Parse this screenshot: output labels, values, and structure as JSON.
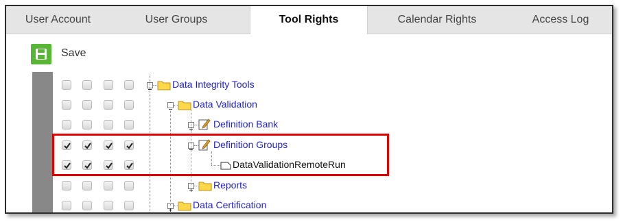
{
  "tabs": [
    {
      "label": "User Account",
      "active": false
    },
    {
      "label": "User Groups",
      "active": false
    },
    {
      "label": "Tool Rights",
      "active": true
    },
    {
      "label": "Calendar Rights",
      "active": false
    },
    {
      "label": "Access Log",
      "active": false
    }
  ],
  "toolbar": {
    "save_label": "Save"
  },
  "tree": {
    "rows": [
      {
        "label": "Data Integrity Tools",
        "icon": "folder-icon",
        "expanded": true,
        "checked": false
      },
      {
        "label": "Data Validation",
        "icon": "folder-icon",
        "expanded": true,
        "checked": false
      },
      {
        "label": "Definition Bank",
        "icon": "edit-document-icon",
        "expanded": false,
        "checked": false
      },
      {
        "label": "Definition Groups",
        "icon": "edit-document-icon",
        "expanded": true,
        "checked": true
      },
      {
        "label": "DataValidationRemoteRun",
        "icon": "page-icon",
        "expanded": null,
        "checked": true
      },
      {
        "label": "Reports",
        "icon": "folder-icon",
        "expanded": false,
        "checked": false
      },
      {
        "label": "Data Certification",
        "icon": "folder-icon",
        "expanded": false,
        "checked": false
      }
    ]
  },
  "colors": {
    "link": "#2323c8",
    "highlight": "#e00000",
    "save_green": "#58b535",
    "folder_yellow": "#ffd84a"
  }
}
